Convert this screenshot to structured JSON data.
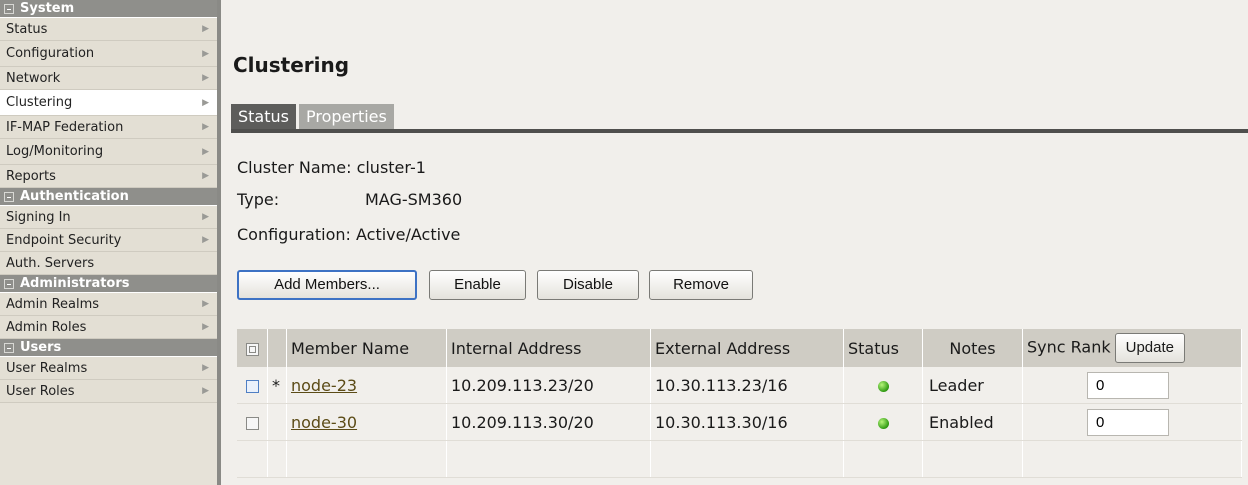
{
  "sidebar": {
    "sections": [
      {
        "title": "System",
        "items": [
          "Status",
          "Configuration",
          "Network",
          "Clustering",
          "IF-MAP Federation",
          "Log/Monitoring",
          "Reports"
        ]
      },
      {
        "title": "Authentication",
        "items": [
          "Signing In",
          "Endpoint Security",
          "Auth. Servers"
        ]
      },
      {
        "title": "Administrators",
        "items": [
          "Admin Realms",
          "Admin Roles"
        ]
      },
      {
        "title": "Users",
        "items": [
          "User Realms",
          "User Roles"
        ]
      }
    ],
    "active_item": "Clustering"
  },
  "page": {
    "title": "Clustering",
    "tabs": [
      "Status",
      "Properties"
    ],
    "active_tab": "Status"
  },
  "cluster": {
    "name_label": "Cluster Name:",
    "name_value": "cluster-1",
    "type_label": "Type:",
    "type_value": "MAG-SM360",
    "config_label": "Configuration:",
    "config_value": "Active/Active"
  },
  "actions": {
    "add_members": "Add Members...",
    "enable": "Enable",
    "disable": "Disable",
    "remove": "Remove"
  },
  "table": {
    "headers": [
      "Member Name",
      "Internal Address",
      "External Address",
      "Status",
      "Notes",
      "Sync Rank"
    ],
    "update_label": "Update",
    "rows": [
      {
        "marker": "*",
        "name": "node-23",
        "internal": "10.209.113.23/20",
        "external": "10.30.113.23/16",
        "status": "green",
        "notes": "Leader",
        "rank": "0"
      },
      {
        "marker": "",
        "name": "node-30",
        "internal": "10.209.113.30/20",
        "external": "10.30.113.30/16",
        "status": "green",
        "notes": "Enabled",
        "rank": "0"
      }
    ]
  },
  "colors": {
    "sidebar_header": "#8f8f8b",
    "tab_active": "#5d5d5b",
    "tab_inactive": "#a8a8a4",
    "status_ok": "#2f9a12",
    "primary_button_border": "#3d72c4"
  }
}
